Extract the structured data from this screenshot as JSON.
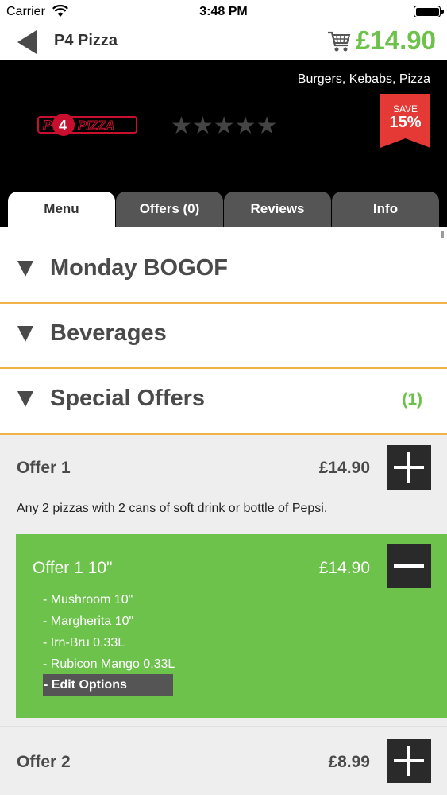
{
  "status_bar": {
    "carrier": "Carrier",
    "time": "3:48 PM",
    "wifi_icon": "wifi-icon",
    "battery_icon": "battery-full-icon"
  },
  "nav": {
    "back_icon": "back-arrow-icon",
    "title": "P4 Pizza",
    "cart_icon": "shopping-cart-icon",
    "cart_total": "£14.90"
  },
  "restaurant": {
    "cuisines": "Burgers, Kebabs, Pizza",
    "logo_text": "P4 PIZZA",
    "rating_stars": "★★★★★",
    "rating_filled": 0,
    "rating_max": 5,
    "save_label": "SAVE",
    "save_value": "15%"
  },
  "tabs": [
    {
      "label": "Menu",
      "active": true
    },
    {
      "label": "Offers (0)",
      "active": false
    },
    {
      "label": "Reviews",
      "active": false
    },
    {
      "label": "Info",
      "active": false
    }
  ],
  "categories": [
    {
      "name": "Monday BOGOF",
      "count": ""
    },
    {
      "name": "Beverages",
      "count": ""
    },
    {
      "name": "Special Offers",
      "count": "(1)"
    }
  ],
  "offers": [
    {
      "title": "Offer 1",
      "price": "£14.90",
      "description": "Any 2 pizzas with 2 cans of soft drink or bottle of Pepsi.",
      "selected": {
        "title": "Offer 1 10\"",
        "price": "£14.90",
        "items": [
          "- Mushroom 10\"",
          "- Margherita 10\"",
          "- Irn-Bru 0.33L",
          "- Rubicon Mango 0.33L"
        ],
        "edit_label": "- Edit Options"
      }
    },
    {
      "title": "Offer 2",
      "price": "£8.99"
    }
  ],
  "colors": {
    "accent_green": "#6cc24a",
    "divider_orange": "#f0b34a",
    "badge_red": "#e53935",
    "header_black": "#000000",
    "dark_button": "#2a2a2a"
  }
}
